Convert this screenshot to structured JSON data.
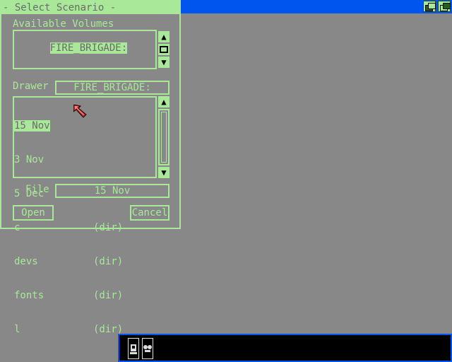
{
  "requester": {
    "title": "- Select Scenario -",
    "volumes_label": "Available Volumes",
    "volumes": [
      {
        "name": "FIRE_BRIGADE:",
        "selected": true
      }
    ],
    "drawer_label": "Drawer",
    "drawer_value": "FIRE_BRIGADE:",
    "files": [
      {
        "name": "15 Nov",
        "type": "",
        "selected": true
      },
      {
        "name": "3 Nov",
        "type": "",
        "selected": false
      },
      {
        "name": "5 Dec",
        "type": "",
        "selected": false
      },
      {
        "name": "c",
        "type": "(dir)",
        "selected": false
      },
      {
        "name": "devs",
        "type": "(dir)",
        "selected": false
      },
      {
        "name": "fonts",
        "type": "(dir)",
        "selected": false
      },
      {
        "name": "l",
        "type": "(dir)",
        "selected": false
      }
    ],
    "file_label": "File",
    "file_value": "15 Nov",
    "open_label": "Open",
    "cancel_label": "Cancel"
  },
  "icons": {
    "up": "up-arrow-icon",
    "down": "down-arrow-icon",
    "depth": "depth-gadget-icon",
    "pointer": "mouse-pointer-icon"
  },
  "colors": {
    "background": "#888888",
    "accent": "#a8e898",
    "screen_bar": "#0055ee",
    "pointer": "#cc2222"
  }
}
